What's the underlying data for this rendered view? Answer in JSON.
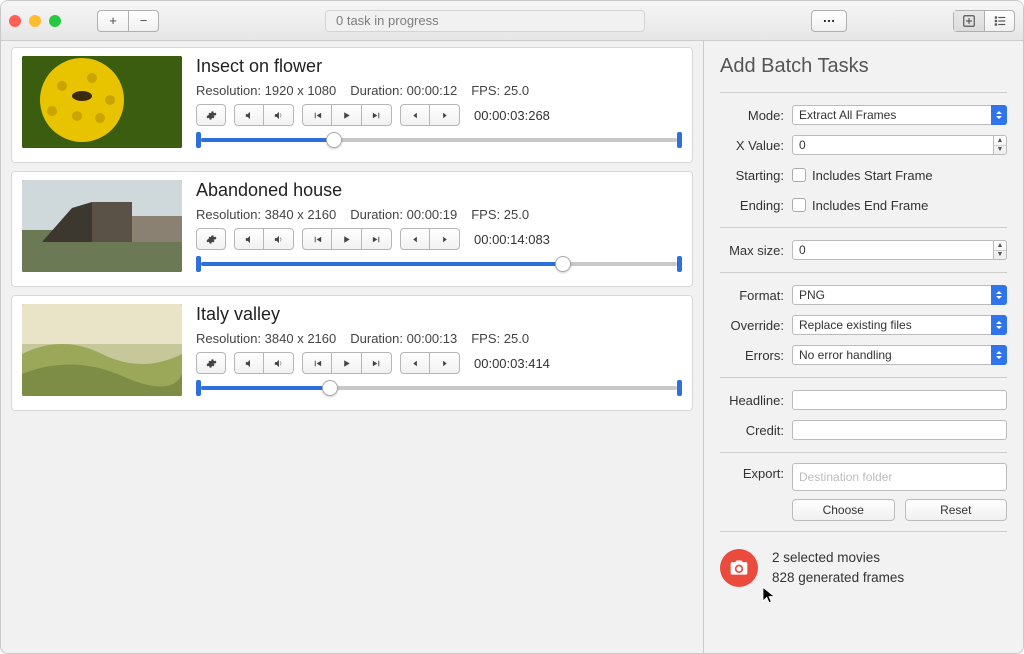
{
  "toolbar": {
    "status": "0 task in progress",
    "plus": "+",
    "minus": "−",
    "ellipsis": "…"
  },
  "items": [
    {
      "title": "Insect on flower",
      "resolution_label": "Resolution:",
      "resolution": "1920 x 1080",
      "duration_label": "Duration:",
      "duration": "00:00:12",
      "fps_label": "FPS:",
      "fps": "25.0",
      "timestamp": "00:00:03:268",
      "progress_pct": 28
    },
    {
      "title": "Abandoned house",
      "resolution_label": "Resolution:",
      "resolution": "3840 x 2160",
      "duration_label": "Duration:",
      "duration": "00:00:19",
      "fps_label": "FPS:",
      "fps": "25.0",
      "timestamp": "00:00:14:083",
      "progress_pct": 76
    },
    {
      "title": "Italy valley",
      "resolution_label": "Resolution:",
      "resolution": "3840 x 2160",
      "duration_label": "Duration:",
      "duration": "00:00:13",
      "fps_label": "FPS:",
      "fps": "25.0",
      "timestamp": "00:00:03:414",
      "progress_pct": 27
    }
  ],
  "side": {
    "title": "Add Batch Tasks",
    "mode_label": "Mode:",
    "mode_value": "Extract All Frames",
    "x_label": "X Value:",
    "x_value": "0",
    "start_label": "Starting:",
    "start_opt": "Includes Start Frame",
    "end_label": "Ending:",
    "end_opt": "Includes End Frame",
    "max_label": "Max size:",
    "max_value": "0",
    "format_label": "Format:",
    "format_value": "PNG",
    "override_label": "Override:",
    "override_value": "Replace existing files",
    "errors_label": "Errors:",
    "errors_value": "No error handling",
    "headline_label": "Headline:",
    "credit_label": "Credit:",
    "export_label": "Export:",
    "export_placeholder": "Destination folder",
    "choose": "Choose",
    "reset": "Reset",
    "summary_line1": "2 selected movies",
    "summary_line2": "828 generated frames"
  }
}
